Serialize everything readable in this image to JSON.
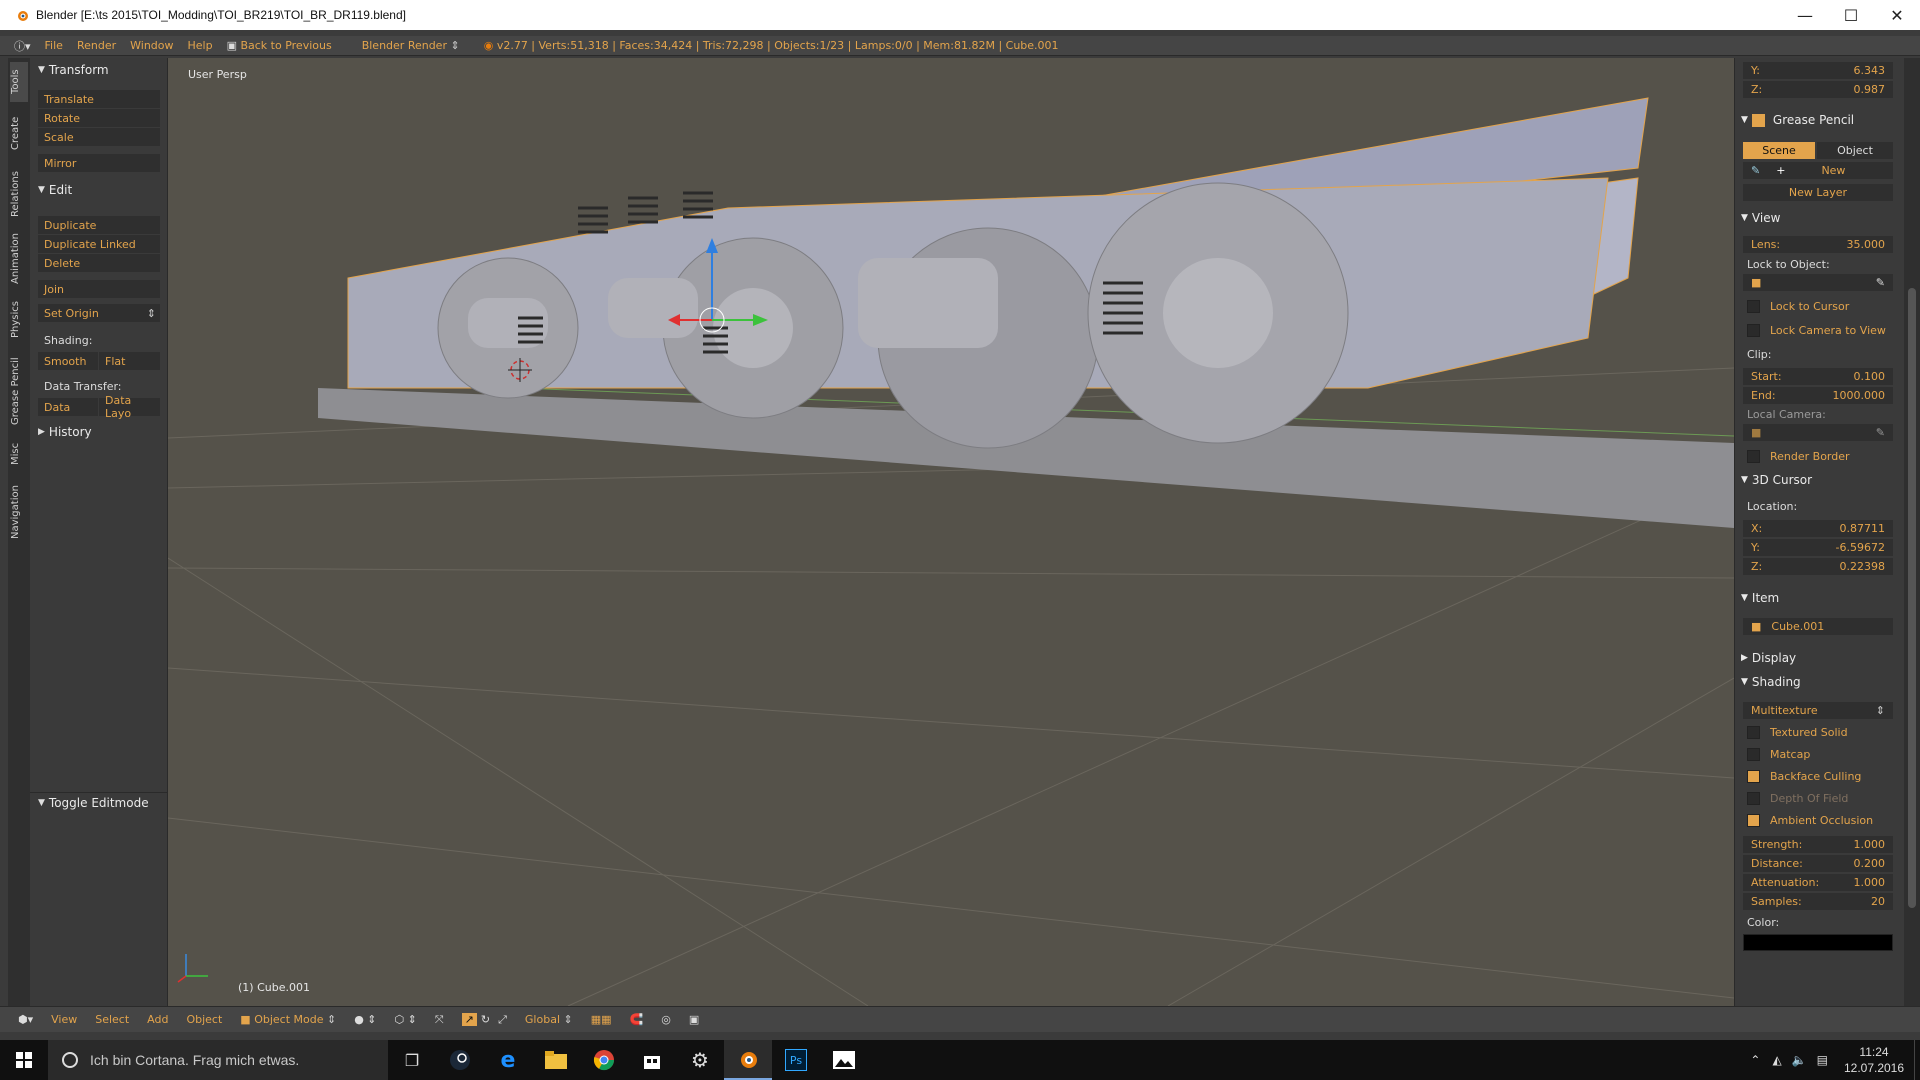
{
  "window": {
    "title": "Blender [E:\\ts 2015\\TOI_Modding\\TOI_BR219\\TOI_BR_DR119.blend]",
    "minimize": "—",
    "maximize": "☐",
    "close": "✕"
  },
  "menu": {
    "items": [
      "File",
      "Render",
      "Window",
      "Help"
    ],
    "back": "Back to Previous",
    "engine": "Blender Render",
    "stats": "v2.77 | Verts:51,318 | Faces:34,424 | Tris:72,298 | Objects:1/23 | Lamps:0/0 | Mem:81.82M | Cube.001"
  },
  "tool_tabs": [
    "Tools",
    "Create",
    "Relations",
    "Animation",
    "Physics",
    "Grease Pencil",
    "Misc",
    "Navigation"
  ],
  "toolshelf": {
    "transform": {
      "title": "Transform",
      "translate": "Translate",
      "rotate": "Rotate",
      "scale": "Scale",
      "mirror": "Mirror"
    },
    "edit": {
      "title": "Edit",
      "duplicate": "Duplicate",
      "duplicate_linked": "Duplicate Linked",
      "delete": "Delete",
      "join": "Join",
      "set_origin": "Set Origin",
      "shading_label": "Shading:",
      "smooth": "Smooth",
      "flat": "Flat",
      "data_transfer_label": "Data Transfer:",
      "data": "Data",
      "data_layo": "Data Layo"
    },
    "history": "History",
    "toggle_editmode": "Toggle Editmode"
  },
  "viewport": {
    "view_label": "User Persp",
    "object_label": "(1) Cube.001"
  },
  "properties": {
    "y": {
      "label": "Y:",
      "value": "6.343"
    },
    "z": {
      "label": "Z:",
      "value": "0.987"
    },
    "grease_pencil": {
      "title": "Grease Pencil",
      "scene": "Scene",
      "object": "Object",
      "new": "New",
      "new_layer": "New Layer"
    },
    "view": {
      "title": "View",
      "lens_label": "Lens:",
      "lens": "35.000",
      "lock_to_object": "Lock to Object:",
      "lock_to_cursor": "Lock to Cursor",
      "lock_camera": "Lock Camera to View",
      "clip": "Clip:",
      "start_label": "Start:",
      "start": "0.100",
      "end_label": "End:",
      "end": "1000.000",
      "local_camera": "Local Camera:",
      "render_border": "Render Border"
    },
    "cursor": {
      "title": "3D Cursor",
      "location": "Location:",
      "x_label": "X:",
      "x": "0.87711",
      "y_label": "Y:",
      "y": "-6.59672",
      "z_label": "Z:",
      "z": "0.22398"
    },
    "item": {
      "title": "Item",
      "name": "Cube.001"
    },
    "display": "Display",
    "shading": {
      "title": "Shading",
      "mode": "Multitexture",
      "textured_solid": "Textured Solid",
      "matcap": "Matcap",
      "backface_culling": "Backface Culling",
      "depth_of_field": "Depth Of Field",
      "ambient_occlusion": "Ambient Occlusion",
      "strength_label": "Strength:",
      "strength": "1.000",
      "distance_label": "Distance:",
      "distance": "0.200",
      "attenuation_label": "Attenuation:",
      "attenuation": "1.000",
      "samples_label": "Samples:",
      "samples": "20",
      "color_label": "Color:"
    }
  },
  "bottom": {
    "view": "View",
    "select": "Select",
    "add": "Add",
    "object": "Object",
    "mode": "Object Mode",
    "orientation": "Global"
  },
  "taskbar": {
    "search": "Ich bin Cortana. Frag mich etwas.",
    "time": "11:24",
    "date": "12.07.2016"
  }
}
